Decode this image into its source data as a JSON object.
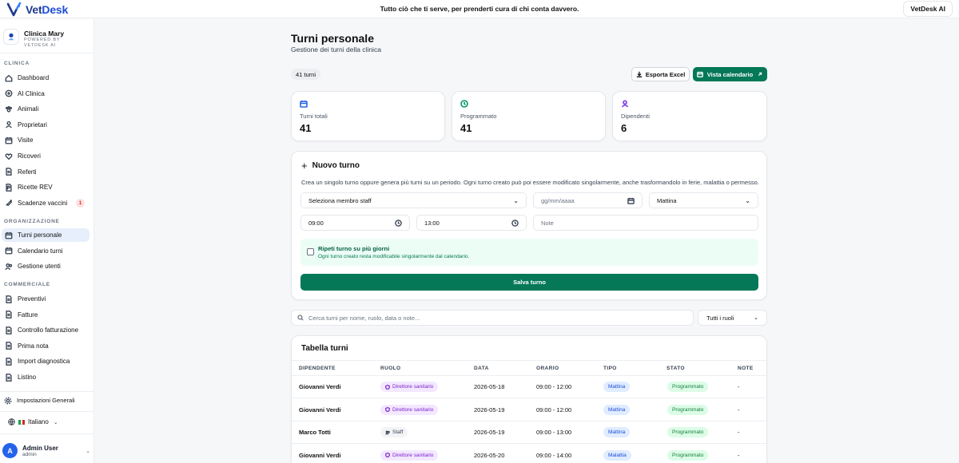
{
  "topbar": {
    "brand_name_a": "Vet",
    "brand_name_b": "Desk",
    "tagline": "Tutto ciò che ti serve, per prenderti cura di chi conta davvero.",
    "ai_button": "VetDesk AI"
  },
  "sidebar": {
    "clinic_name": "Clinica Mary",
    "clinic_sub": "POWERED BY VETDESK AI",
    "section_clinica": "CLINICA",
    "section_org": "ORGANIZZAZIONE",
    "section_comm": "COMMERCIALE",
    "clinica_items": [
      {
        "label": "Dashboard",
        "icon": "home-icon"
      },
      {
        "label": "AI Clinica",
        "icon": "sparkle-icon"
      },
      {
        "label": "Animali",
        "icon": "paw-icon"
      },
      {
        "label": "Proprietari",
        "icon": "user-icon"
      },
      {
        "label": "Visite",
        "icon": "calendar-icon"
      },
      {
        "label": "Ricoveri",
        "icon": "heart-icon"
      },
      {
        "label": "Referti",
        "icon": "document-icon"
      },
      {
        "label": "Ricette REV",
        "icon": "prescription-icon"
      },
      {
        "label": "Scadenze vaccini",
        "icon": "syringe-icon",
        "badge": "1"
      }
    ],
    "org_items": [
      {
        "label": "Turni personale",
        "icon": "calendar-icon",
        "active": true
      },
      {
        "label": "Calendario turni",
        "icon": "calendar-icon"
      },
      {
        "label": "Gestione utenti",
        "icon": "users-icon"
      }
    ],
    "comm_items": [
      {
        "label": "Preventivi",
        "icon": "document-icon"
      },
      {
        "label": "Fatture",
        "icon": "document-icon"
      },
      {
        "label": "Controllo fatturazione",
        "icon": "document-icon"
      },
      {
        "label": "Prima nota",
        "icon": "document-icon"
      },
      {
        "label": "Import diagnostica",
        "icon": "document-icon"
      },
      {
        "label": "Listino",
        "icon": "document-icon"
      }
    ],
    "settings_label": "Impostazioni Generali",
    "language": "Italiano",
    "user_name": "Admin User",
    "user_role": "admin",
    "user_initial": "A"
  },
  "main": {
    "title": "Turni personale",
    "subtitle": "Gestione dei turni della clinica",
    "count_chip": "41 turni",
    "export_button": "Esporta Excel",
    "calendar_button": "Vista calendario"
  },
  "stats": [
    {
      "label": "Turni totali",
      "value": "41",
      "icon": "calendar-icon",
      "color": "#2563eb"
    },
    {
      "label": "Programmato",
      "value": "41",
      "icon": "clock-icon",
      "color": "#059669"
    },
    {
      "label": "Dipendenti",
      "value": "6",
      "icon": "user-icon",
      "color": "#7c3aed"
    }
  ],
  "form": {
    "title": "Nuovo turno",
    "description": "Crea un singolo turno oppure genera più turni su un periodo. Ogni turno creato può poi essere modificato singolarmente, anche trasformandolo in ferie, malattia o permesso.",
    "staff_select": "Seleziona membro staff",
    "date_placeholder": "gg/mm/aaaa",
    "shift_select": "Mattina",
    "start_time": "09:00",
    "end_time": "13:00",
    "note_placeholder": "Note",
    "repeat_title": "Ripeti turno su più giorni",
    "repeat_sub": "Ogni turno creato resta modificabile singolarmente dal calendario.",
    "save_button": "Salva turno"
  },
  "filters": {
    "search_placeholder": "Cerca turni per nome, ruolo, data o note...",
    "role_filter": "Tutti i ruoli"
  },
  "table": {
    "title": "Tabella turni",
    "headers": [
      "DIPENDENTE",
      "RUOLO",
      "DATA",
      "ORARIO",
      "TIPO",
      "STATO",
      "NOTE"
    ],
    "rows": [
      {
        "dipendente": "Giovanni Verdi",
        "ruolo": "Direttore sanitario",
        "ruolo_type": "ds",
        "data": "2026-05-18",
        "orario": "09:00 - 12:00",
        "tipo": "Mattina",
        "stato": "Programmato",
        "note": "-"
      },
      {
        "dipendente": "Giovanni Verdi",
        "ruolo": "Direttore sanitario",
        "ruolo_type": "ds",
        "data": "2026-05-19",
        "orario": "09:00 - 12:00",
        "tipo": "Mattina",
        "stato": "Programmato",
        "note": "-"
      },
      {
        "dipendente": "Marco Totti",
        "ruolo": "Staff",
        "ruolo_type": "st",
        "data": "2026-05-19",
        "orario": "09:00 - 13:00",
        "tipo": "Mattina",
        "stato": "Programmato",
        "note": "-"
      },
      {
        "dipendente": "Giovanni Verdi",
        "ruolo": "Direttore sanitario",
        "ruolo_type": "ds",
        "data": "2026-05-20",
        "orario": "09:00 - 14:00",
        "tipo": "Malattia",
        "stato": "Programmato",
        "note": "-"
      }
    ]
  }
}
